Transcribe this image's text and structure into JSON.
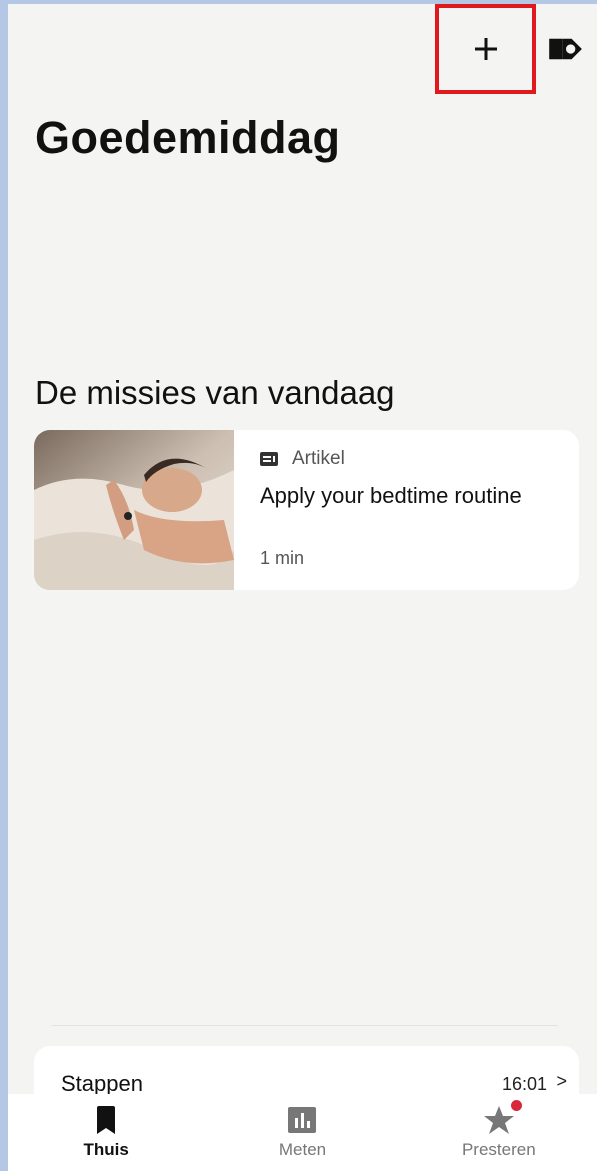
{
  "header": {
    "add_icon": "plus-icon",
    "device_icon": "watch-device-icon"
  },
  "greeting": "Goedemiddag",
  "missions": {
    "section_title": "De missies van vandaag",
    "items": [
      {
        "type_icon": "article-icon",
        "type": "Artikel",
        "title": "Apply your bedtime routine",
        "duration": "1 min"
      }
    ]
  },
  "steps": {
    "title": "Stappen",
    "time": "16:01",
    "chevron": ">"
  },
  "nav": {
    "items": [
      {
        "label": "Thuis",
        "icon": "home-icon",
        "active": true
      },
      {
        "label": "Meten",
        "icon": "bar-chart-icon",
        "active": false
      },
      {
        "label": "Presteren",
        "icon": "star-icon",
        "active": false,
        "badge_color": "#d6283a"
      }
    ]
  },
  "colors": {
    "background": "#f4f4f2",
    "highlight_box": "#e0191e",
    "accent_badge": "#d6283a",
    "text": "#111111"
  }
}
